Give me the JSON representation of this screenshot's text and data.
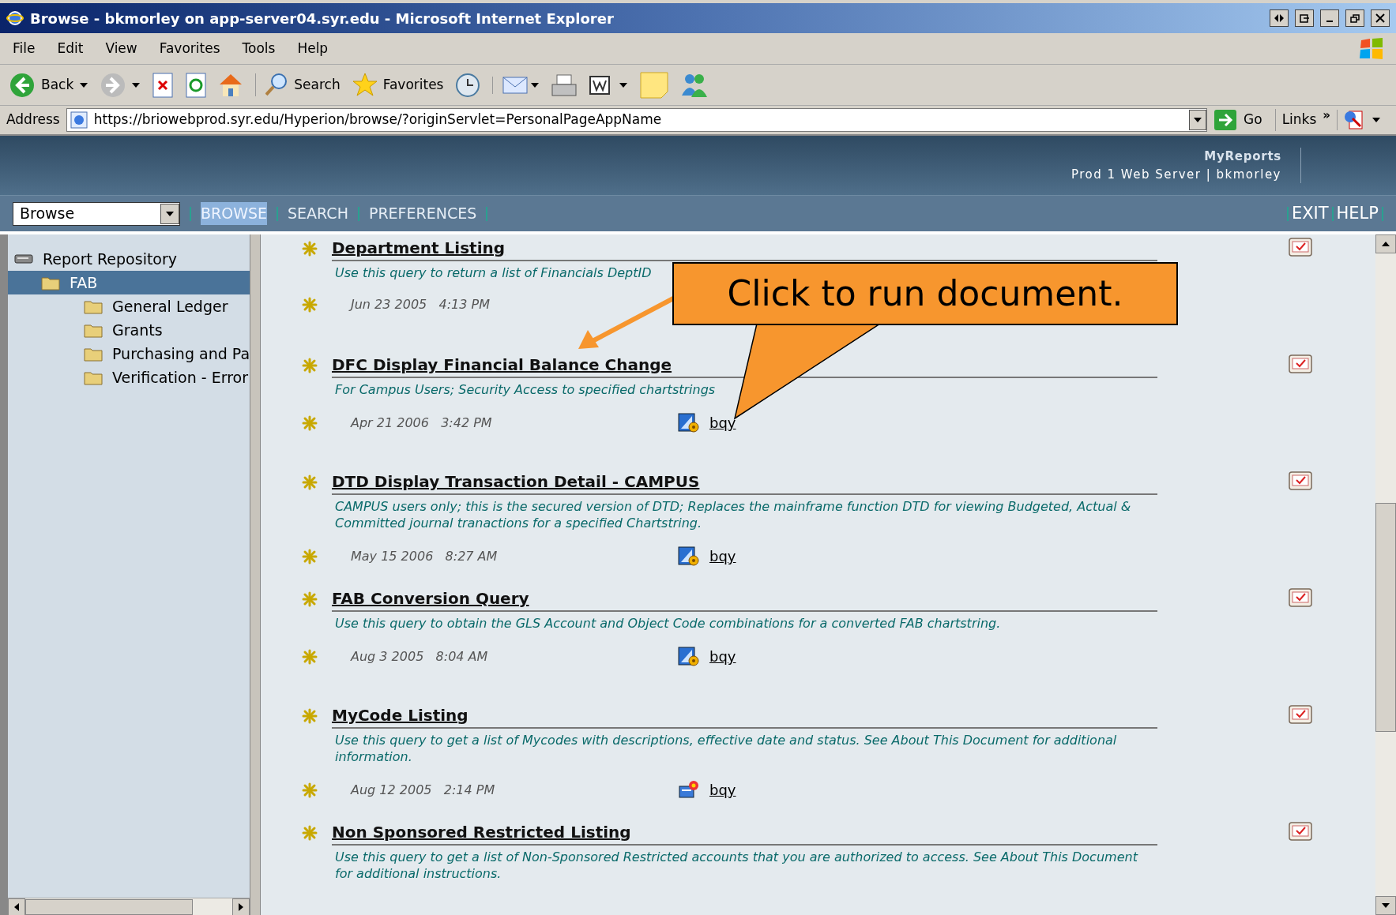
{
  "window": {
    "title": "Browse - bkmorley on app-server04.syr.edu - Microsoft Internet Explorer"
  },
  "menu": [
    "File",
    "Edit",
    "View",
    "Favorites",
    "Tools",
    "Help"
  ],
  "toolbar": {
    "back": "Back",
    "search": "Search",
    "favorites": "Favorites"
  },
  "address": {
    "label": "Address",
    "value": "https://briowebprod.syr.edu/Hyperion/browse/?originServlet=PersonalPageAppName",
    "go": "Go",
    "links": "Links",
    "links_more": "»"
  },
  "header": {
    "app": "MyReports",
    "server": "Prod 1 Web Server | bkmorley"
  },
  "nav": {
    "dropdown": "Browse",
    "tabs": [
      {
        "label": "BROWSE",
        "selected": true
      },
      {
        "label": "SEARCH",
        "selected": false
      },
      {
        "label": "PREFERENCES",
        "selected": false
      }
    ],
    "right": [
      "EXIT",
      "HELP"
    ]
  },
  "tree": [
    {
      "label": "Report Repository",
      "kind": "root",
      "selected": false,
      "children": [
        {
          "label": "FAB",
          "kind": "folder",
          "selected": true,
          "children": [
            {
              "label": "General Ledger",
              "kind": "folder",
              "selected": false
            },
            {
              "label": "Grants",
              "kind": "folder",
              "selected": false
            },
            {
              "label": "Purchasing and Pa",
              "kind": "folder",
              "selected": false
            },
            {
              "label": "Verification - Error",
              "kind": "folder",
              "selected": false
            }
          ]
        }
      ]
    }
  ],
  "documents": [
    {
      "title": "Department Listing",
      "description": "Use this query to return a list of Financials DeptID",
      "date": "Jun 23 2005   4:13 PM"
    },
    {
      "title": "DFC Display Financial Balance Change",
      "description": "For Campus Users; Security Access to specified chartstrings",
      "date": "Apr 21 2006   3:42 PM",
      "file": "bqy",
      "kind": "query"
    },
    {
      "title": "DTD Display Transaction Detail - CAMPUS",
      "description": "CAMPUS users only; this is the secured version of DTD; Replaces the mainframe function DTD for viewing Budgeted, Actual & Committed journal tranactions for a specified Chartstring.",
      "date": "May 15 2006   8:27 AM",
      "file": "bqy",
      "kind": "query"
    },
    {
      "title": "FAB Conversion Query",
      "description": "Use this query to obtain the GLS Account and Object Code combinations for a converted FAB chartstring.",
      "date": "Aug 3 2005   8:04 AM",
      "file": "bqy",
      "kind": "query"
    },
    {
      "title": "MyCode Listing",
      "description": "Use this query to get a list of Mycodes with descriptions, effective date and status. See About This Document for additional information.",
      "date": "Aug 12 2005   2:14 PM",
      "file": "bqy",
      "kind": "report"
    },
    {
      "title": "Non Sponsored Restricted Listing",
      "description": "Use this query to get a list of Non-Sponsored Restricted accounts that you are authorized to access. See About This Document for additional instructions."
    }
  ],
  "callout": {
    "text": "Click to run document."
  }
}
